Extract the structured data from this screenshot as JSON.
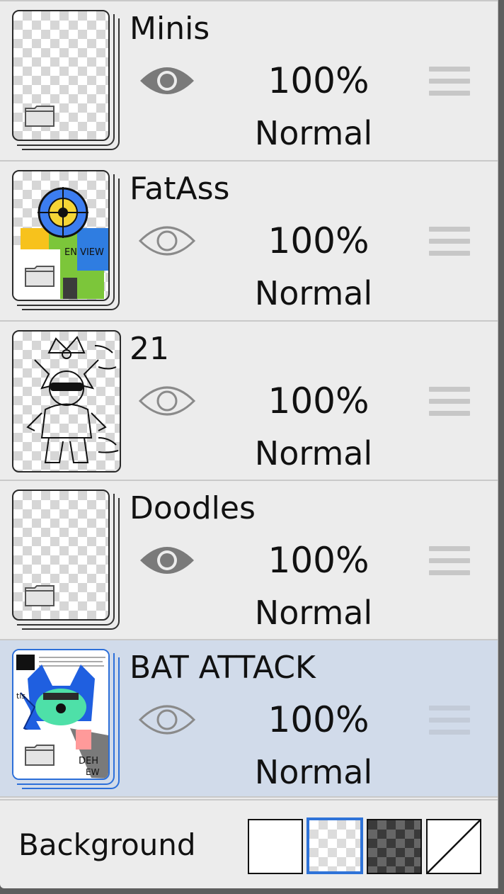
{
  "layers": [
    {
      "name": "Minis",
      "opacity": "100%",
      "blend": "Normal",
      "visible": true,
      "is_folder": true,
      "selected": false,
      "thumb": "empty-transparent",
      "eye_icon": "eye-filled-icon"
    },
    {
      "name": "FatAss",
      "opacity": "100%",
      "blend": "Normal",
      "visible": false,
      "is_folder": true,
      "selected": false,
      "thumb": "colorful-character-art",
      "eye_icon": "eye-outline-icon"
    },
    {
      "name": "21",
      "opacity": "100%",
      "blend": "Normal",
      "visible": false,
      "is_folder": false,
      "selected": false,
      "thumb": "lineart-sketch",
      "eye_icon": "eye-outline-icon"
    },
    {
      "name": "Doodles",
      "opacity": "100%",
      "blend": "Normal",
      "visible": true,
      "is_folder": true,
      "selected": false,
      "thumb": "empty-transparent",
      "eye_icon": "eye-filled-icon"
    },
    {
      "name": "BAT ATTACK",
      "opacity": "100%",
      "blend": "Normal",
      "visible": false,
      "is_folder": true,
      "selected": true,
      "thumb": "blue-bat-character-art",
      "eye_icon": "eye-outline-icon"
    }
  ],
  "background": {
    "label": "Background",
    "options": [
      "white",
      "transparent",
      "dark-checker",
      "none"
    ],
    "selected": "transparent"
  },
  "colors": {
    "panel": "#ececec",
    "selected_row": "#d1dbea",
    "accent": "#2f73d8"
  }
}
